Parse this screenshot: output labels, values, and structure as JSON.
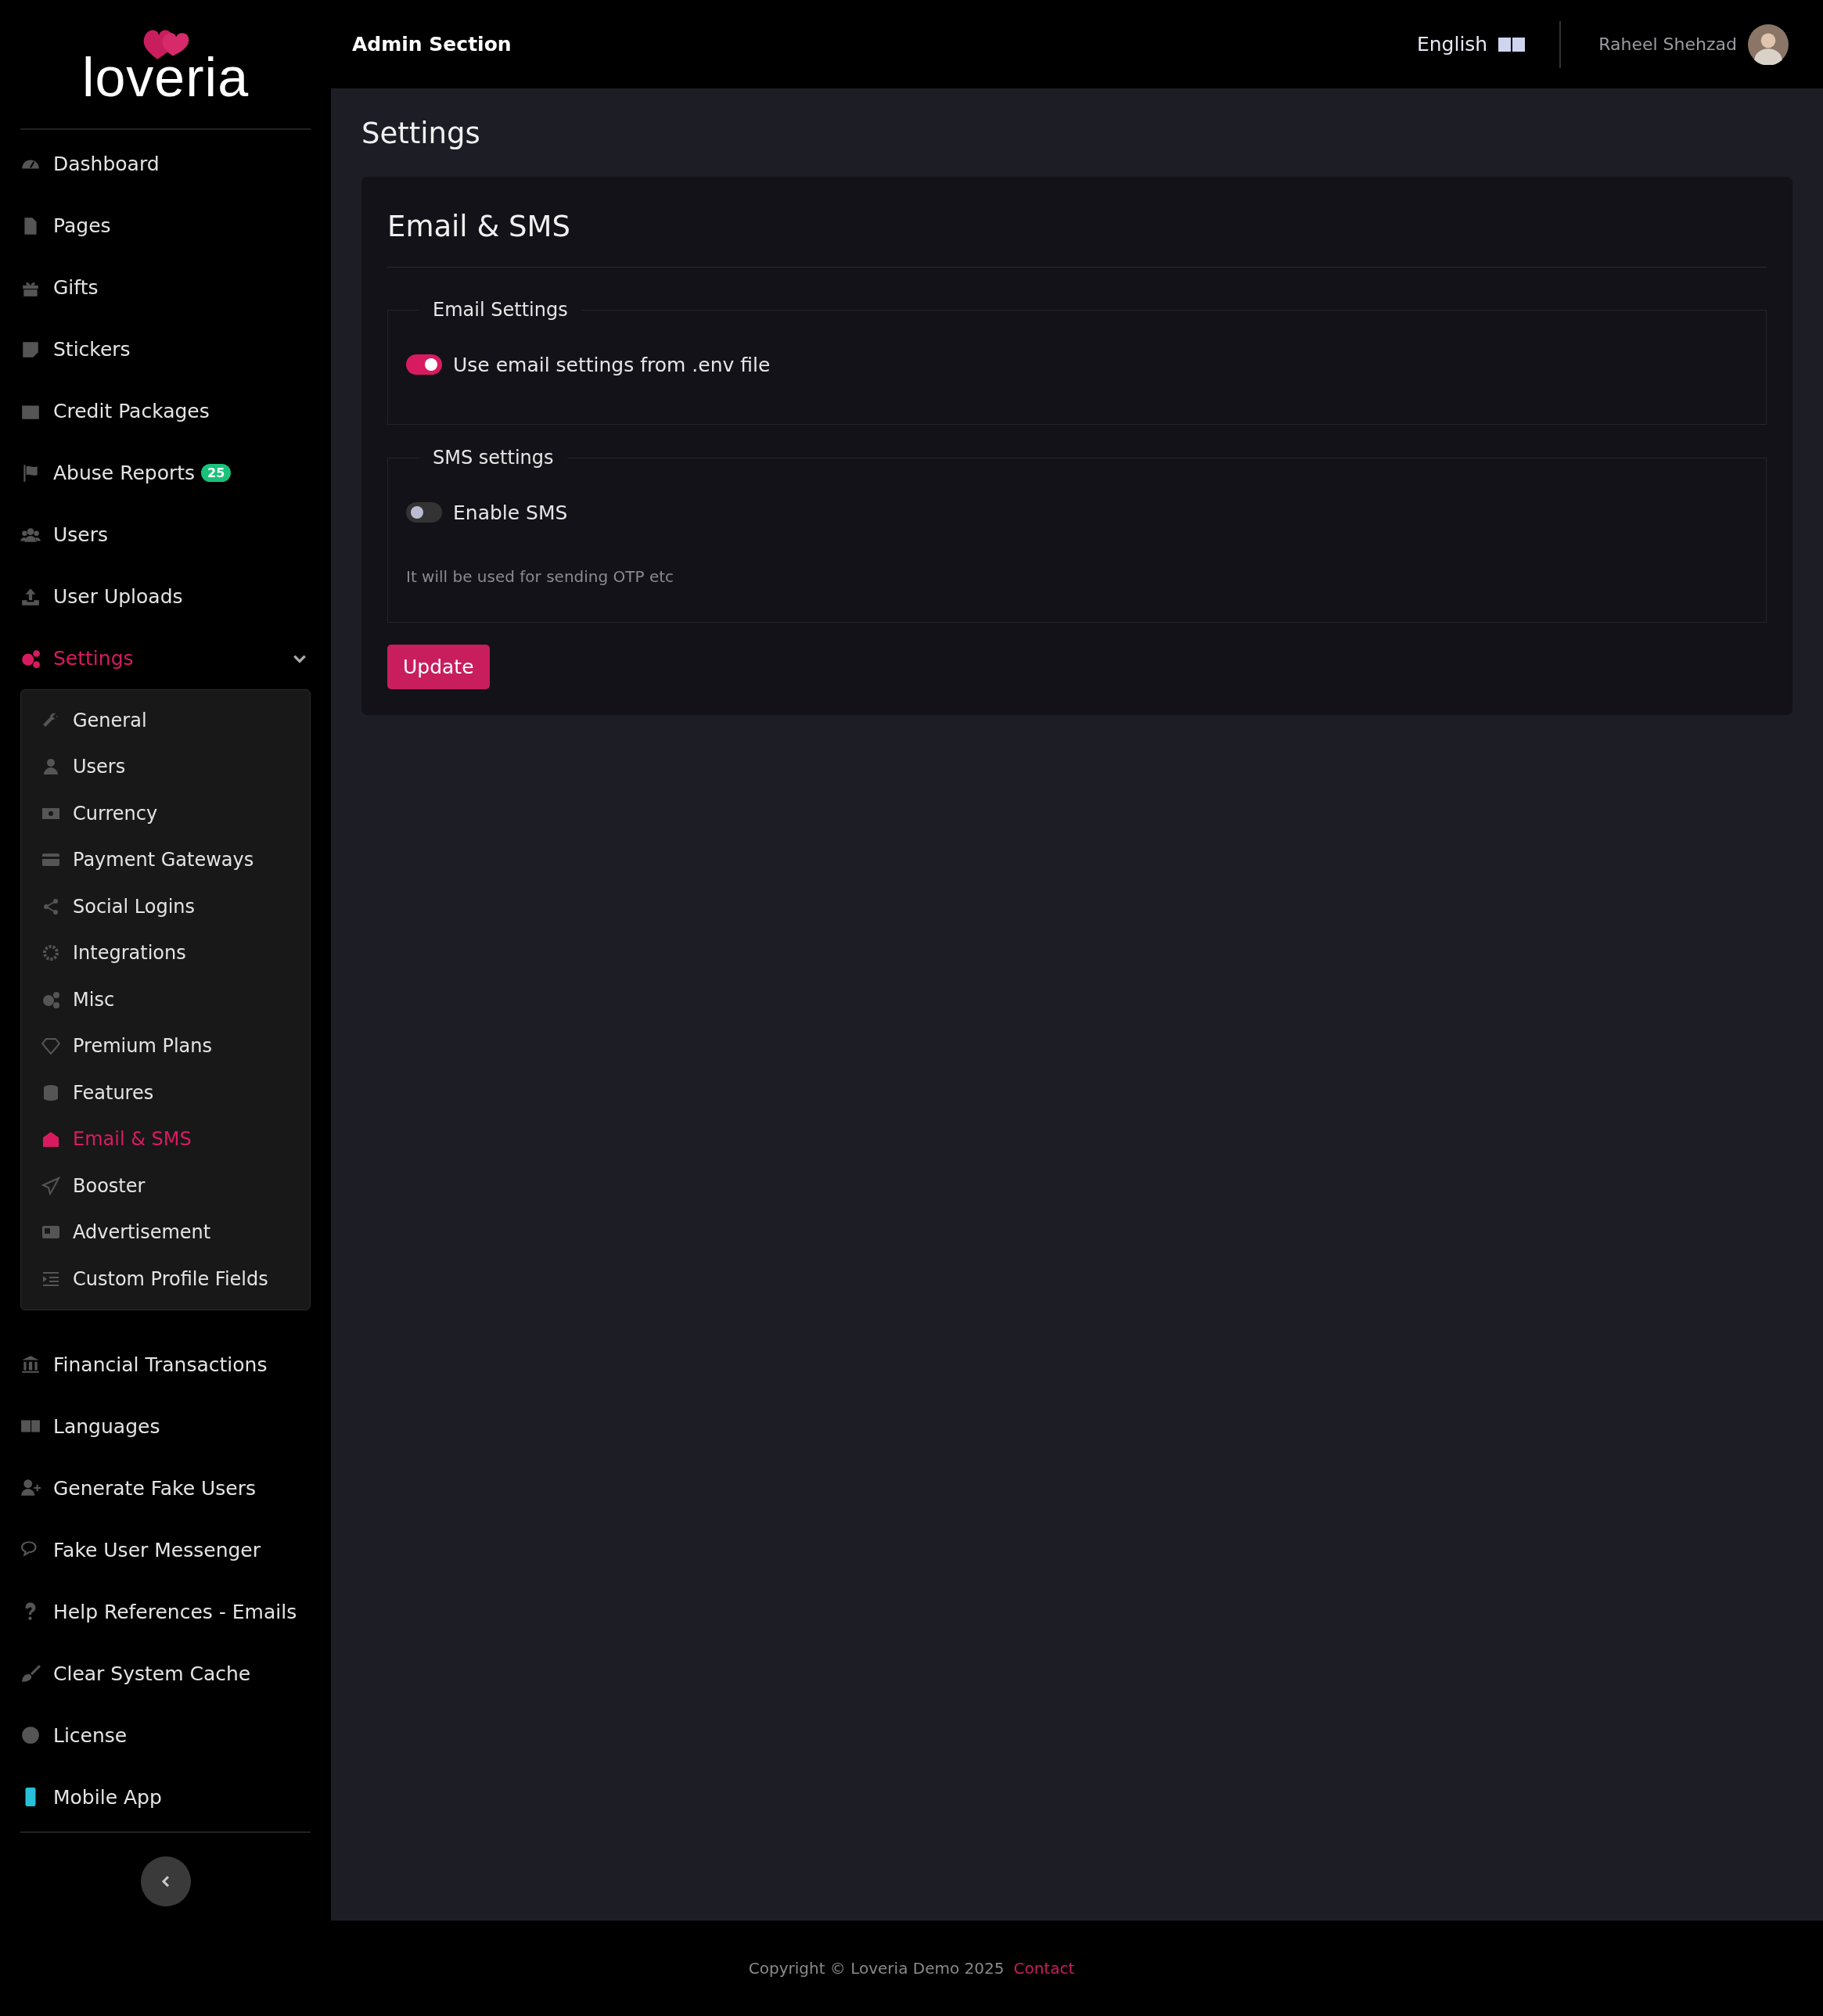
{
  "logo": {
    "text": "loveria"
  },
  "header": {
    "title": "Admin Section",
    "language": "English",
    "user_name": "Raheel Shehzad"
  },
  "sidebar": {
    "items": [
      {
        "label": "Dashboard",
        "selected": false
      },
      {
        "label": "Pages",
        "selected": false
      },
      {
        "label": "Gifts",
        "selected": false
      },
      {
        "label": "Stickers",
        "selected": false
      },
      {
        "label": "Credit Packages",
        "selected": false
      },
      {
        "label": "Abuse Reports",
        "badge": "25",
        "selected": false
      },
      {
        "label": "Users",
        "selected": false
      },
      {
        "label": "User Uploads",
        "selected": false
      },
      {
        "label": "Settings",
        "selected": true,
        "expanded": true,
        "children": [
          {
            "label": "General",
            "selected": false
          },
          {
            "label": "Users",
            "selected": false
          },
          {
            "label": "Currency",
            "selected": false
          },
          {
            "label": "Payment Gateways",
            "selected": false
          },
          {
            "label": "Social Logins",
            "selected": false
          },
          {
            "label": "Integrations",
            "selected": false
          },
          {
            "label": "Misc",
            "selected": false
          },
          {
            "label": "Premium Plans",
            "selected": false
          },
          {
            "label": "Features",
            "selected": false
          },
          {
            "label": "Email & SMS",
            "selected": true
          },
          {
            "label": "Booster",
            "selected": false
          },
          {
            "label": "Advertisement",
            "selected": false
          },
          {
            "label": "Custom Profile Fields",
            "selected": false
          }
        ]
      },
      {
        "label": "Financial Transactions",
        "selected": false
      },
      {
        "label": "Languages",
        "selected": false
      },
      {
        "label": "Generate Fake Users",
        "selected": false
      },
      {
        "label": "Fake User Messenger",
        "selected": false
      },
      {
        "label": "Help References - Emails",
        "selected": false
      },
      {
        "label": "Clear System Cache",
        "selected": false
      },
      {
        "label": "License",
        "selected": false
      },
      {
        "label": "Mobile App",
        "selected": false
      }
    ]
  },
  "page_title": "Settings",
  "card": {
    "title": "Email & SMS",
    "sections": [
      {
        "legend": "Email Settings",
        "toggle": {
          "label": "Use email settings from .env file",
          "on": true
        }
      },
      {
        "legend": "SMS settings",
        "toggle": {
          "label": "Enable SMS",
          "on": false
        },
        "help": "It will be used for sending OTP etc"
      }
    ],
    "button": "Update"
  },
  "footer": {
    "copyright": "Copyright © Loveria Demo 2025",
    "link": "Contact"
  }
}
